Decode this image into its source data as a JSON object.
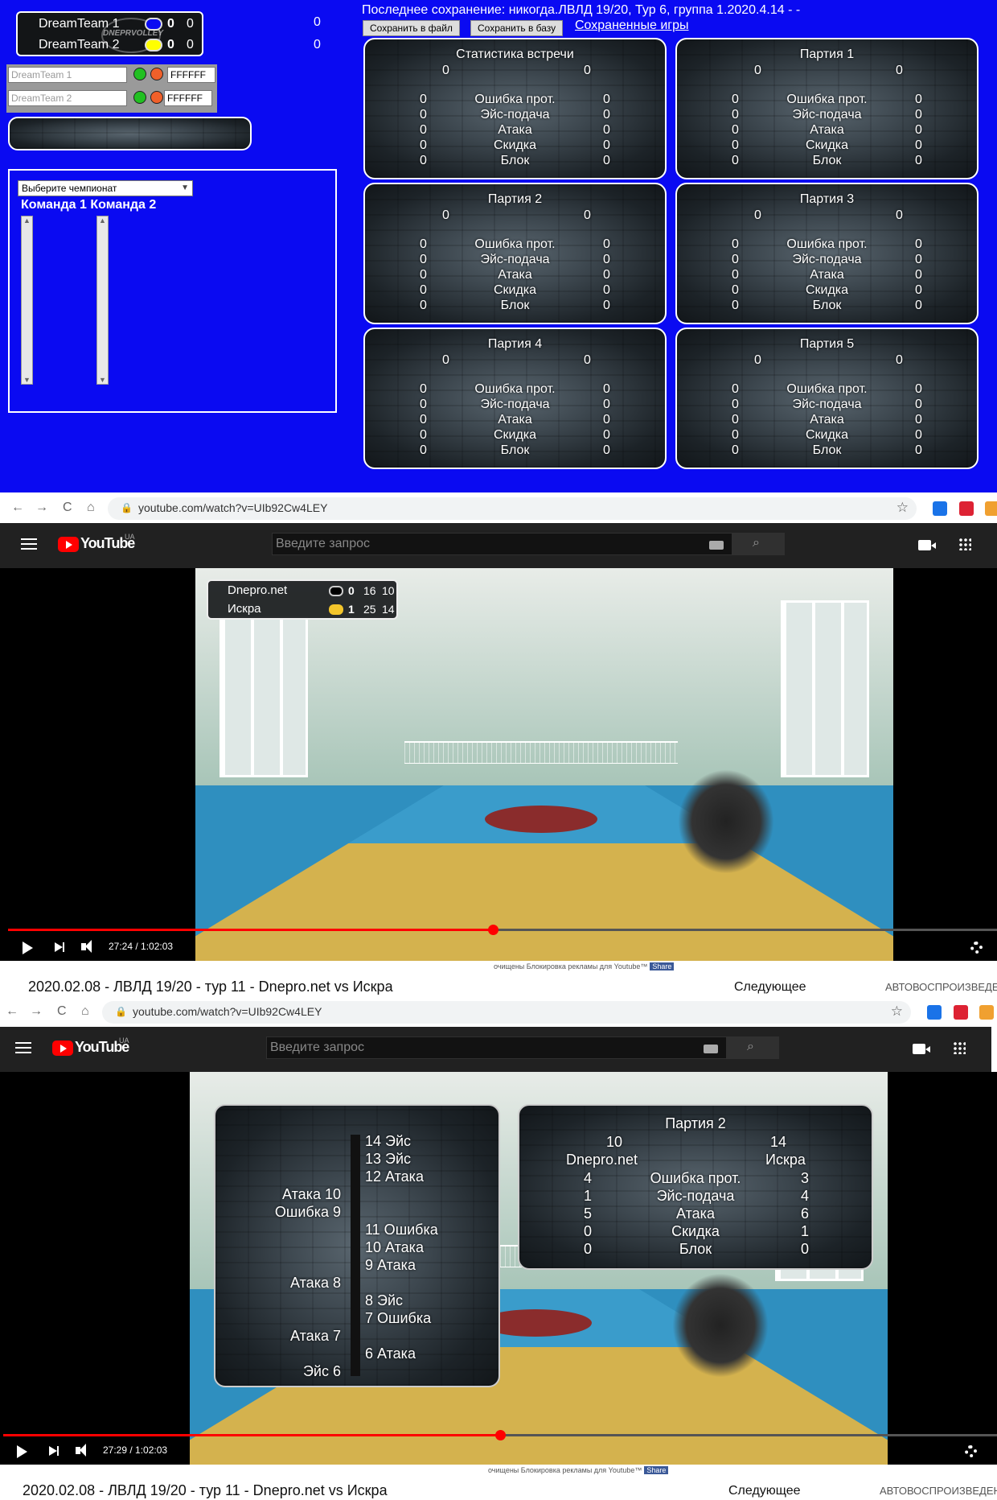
{
  "scoreboard": {
    "team1": {
      "name": "DreamTeam 1",
      "sets": "0",
      "points": "0",
      "color": "#0a0af2"
    },
    "team2": {
      "name": "DreamTeam 2",
      "sets": "0",
      "points": "0",
      "color": "#ffff00"
    },
    "logo_text": "DNEPRVOLLEY",
    "out_score1": "0",
    "out_score2": "0"
  },
  "controls": {
    "team1_placeholder": "DreamTeam 1",
    "team2_placeholder": "DreamTeam 2",
    "team1_hex": "FFFFFF",
    "team2_hex": "FFFFFF",
    "dot_green": "#21c021",
    "dot_orange": "#f0602a"
  },
  "championship": {
    "select_placeholder": "Выберите чемпионат",
    "header": "Команда 1 Команда 2"
  },
  "top": {
    "info": "Последнее сохранение: никогда.ЛВЛД 19/20, Тур 6, группа 1.2020.4.14 - -",
    "save_file": "Сохранить в файл",
    "save_db": "Сохранить в базу",
    "saved_games": "Сохраненные игры"
  },
  "cards": [
    {
      "title": "Статистика встречи",
      "score_left": "0",
      "score_right": "0",
      "rows": [
        {
          "label": "Ошибка прот.",
          "l": "0",
          "r": "0"
        },
        {
          "label": "Эйс-подача",
          "l": "0",
          "r": "0"
        },
        {
          "label": "Атака",
          "l": "0",
          "r": "0"
        },
        {
          "label": "Скидка",
          "l": "0",
          "r": "0"
        },
        {
          "label": "Блок",
          "l": "0",
          "r": "0"
        }
      ]
    },
    {
      "title": "Партия 1",
      "score_left": "0",
      "score_right": "0",
      "rows": [
        {
          "label": "Ошибка прот.",
          "l": "0",
          "r": "0"
        },
        {
          "label": "Эйс-подача",
          "l": "0",
          "r": "0"
        },
        {
          "label": "Атака",
          "l": "0",
          "r": "0"
        },
        {
          "label": "Скидка",
          "l": "0",
          "r": "0"
        },
        {
          "label": "Блок",
          "l": "0",
          "r": "0"
        }
      ]
    },
    {
      "title": "Партия 2",
      "score_left": "0",
      "score_right": "0",
      "rows": [
        {
          "label": "Ошибка прот.",
          "l": "0",
          "r": "0"
        },
        {
          "label": "Эйс-подача",
          "l": "0",
          "r": "0"
        },
        {
          "label": "Атака",
          "l": "0",
          "r": "0"
        },
        {
          "label": "Скидка",
          "l": "0",
          "r": "0"
        },
        {
          "label": "Блок",
          "l": "0",
          "r": "0"
        }
      ]
    },
    {
      "title": "Партия 3",
      "score_left": "0",
      "score_right": "0",
      "rows": [
        {
          "label": "Ошибка прот.",
          "l": "0",
          "r": "0"
        },
        {
          "label": "Эйс-подача",
          "l": "0",
          "r": "0"
        },
        {
          "label": "Атака",
          "l": "0",
          "r": "0"
        },
        {
          "label": "Скидка",
          "l": "0",
          "r": "0"
        },
        {
          "label": "Блок",
          "l": "0",
          "r": "0"
        }
      ]
    },
    {
      "title": "Партия 4",
      "score_left": "0",
      "score_right": "0",
      "rows": [
        {
          "label": "Ошибка прот.",
          "l": "0",
          "r": "0"
        },
        {
          "label": "Эйс-подача",
          "l": "0",
          "r": "0"
        },
        {
          "label": "Атака",
          "l": "0",
          "r": "0"
        },
        {
          "label": "Скидка",
          "l": "0",
          "r": "0"
        },
        {
          "label": "Блок",
          "l": "0",
          "r": "0"
        }
      ]
    },
    {
      "title": "Партия 5",
      "score_left": "0",
      "score_right": "0",
      "rows": [
        {
          "label": "Ошибка прот.",
          "l": "0",
          "r": "0"
        },
        {
          "label": "Эйс-подача",
          "l": "0",
          "r": "0"
        },
        {
          "label": "Атака",
          "l": "0",
          "r": "0"
        },
        {
          "label": "Скидка",
          "l": "0",
          "r": "0"
        },
        {
          "label": "Блок",
          "l": "0",
          "r": "0"
        }
      ]
    }
  ],
  "browser": {
    "url": "youtube.com/watch?v=UIb92Cw4LEY",
    "nav_back": "←",
    "nav_forward": "→",
    "nav_reload": "C",
    "nav_home": "⌂",
    "ext_colors": [
      "#1a73e8",
      "#d23",
      "#f0a030"
    ]
  },
  "youtube": {
    "logo_word": "YouTube",
    "region": "UA",
    "search_placeholder": "Введите запрос",
    "search_icon": "search-icon",
    "ad_text": "очищены Блокировка рекламы для Youtube™",
    "share": "Share",
    "next_label": "Следующее",
    "autoplay_label": "АВТОВОСПРОИЗВЕДЕН"
  },
  "video1": {
    "time": "27:24 / 1:02:03",
    "progress": 0.49,
    "overlay": {
      "team1": "Dnepro.net",
      "team1_sets": "0",
      "team1_s1": "16",
      "team1_s2": "10",
      "team2": "Искра",
      "team2_sets": "1",
      "team2_s1": "25",
      "team2_s2": "14"
    },
    "title": "2020.02.08 - ЛВЛД 19/20 - тур 11 - Dnepro.net vs Искра"
  },
  "video2": {
    "time": "27:29 / 1:02:03",
    "progress": 0.5,
    "timeline_right": [
      "14 Эйс",
      "13 Эйс",
      "12 Атака",
      "11 Ошибка",
      "10 Атака",
      "9 Атака",
      "8 Эйс",
      "7 Ошибка",
      "6 Атака"
    ],
    "timeline_left": [
      "Атака 10",
      "Ошибка 9",
      "Атака 8",
      "Атака 7",
      "Эйс 6"
    ],
    "set_card": {
      "title": "Партия 2",
      "score_left": "10",
      "score_right": "14",
      "team_left": "Dnepro.net",
      "team_right": "Искра",
      "rows": [
        {
          "label": "Ошибка прот.",
          "l": "4",
          "r": "3"
        },
        {
          "label": "Эйс-подача",
          "l": "1",
          "r": "4"
        },
        {
          "label": "Атака",
          "l": "5",
          "r": "6"
        },
        {
          "label": "Скидка",
          "l": "0",
          "r": "1"
        },
        {
          "label": "Блок",
          "l": "0",
          "r": "0"
        }
      ]
    },
    "title": "2020.02.08 - ЛВЛД 19/20 - тур 11 - Dnepro.net vs Искра"
  }
}
